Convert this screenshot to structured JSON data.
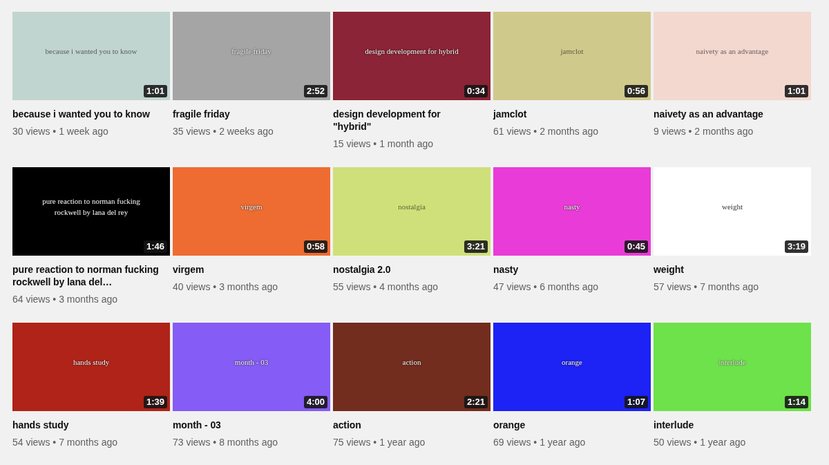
{
  "videos": [
    {
      "title": "because i wanted you to know",
      "meta": "30 views • 1 week ago",
      "duration": "1:01",
      "thumbnail_text": "because i wanted you to know",
      "color": "#c1d5d0",
      "dark_caption": false
    },
    {
      "title": "fragile friday",
      "meta": "35 views • 2 weeks ago",
      "duration": "2:52",
      "thumbnail_text": "fragile friday",
      "color": "#a5a5a5",
      "dark_caption": false
    },
    {
      "title": "design development for \"hybrid\"",
      "meta": "15 views • 1 month ago",
      "duration": "0:34",
      "thumbnail_text": "design development for hybrid",
      "color": "#8b2436",
      "dark_caption": false
    },
    {
      "title": "jamclot",
      "meta": "61 views • 2 months ago",
      "duration": "0:56",
      "thumbnail_text": "jamclot",
      "color": "#d0c98c",
      "dark_caption": false
    },
    {
      "title": "naivety as an advantage",
      "meta": "9 views • 2 months ago",
      "duration": "1:01",
      "thumbnail_text": "naivety as an advantage",
      "color": "#f3d8d0",
      "dark_caption": false
    },
    {
      "title": "pure reaction to norman fucking rockwell by lana del…",
      "meta": "64 views • 3 months ago",
      "duration": "1:46",
      "thumbnail_text": "pure reaction to norman fucking rockwell by lana del rey",
      "color": "#000000",
      "dark_caption": false
    },
    {
      "title": "virgem",
      "meta": "40 views • 3 months ago",
      "duration": "0:58",
      "thumbnail_text": "virgem",
      "color": "#ee6c31",
      "dark_caption": false
    },
    {
      "title": "nostalgia 2.0",
      "meta": "55 views • 4 months ago",
      "duration": "3:21",
      "thumbnail_text": "nostalgia",
      "color": "#cfe07a",
      "dark_caption": false
    },
    {
      "title": "nasty",
      "meta": "47 views • 6 months ago",
      "duration": "0:45",
      "thumbnail_text": "nasty",
      "color": "#e93bd8",
      "dark_caption": false
    },
    {
      "title": "weight",
      "meta": "57 views • 7 months ago",
      "duration": "3:19",
      "thumbnail_text": "weight",
      "color": "#ffffff",
      "dark_caption": true
    },
    {
      "title": "hands study",
      "meta": "54 views • 7 months ago",
      "duration": "1:39",
      "thumbnail_text": "hands study",
      "color": "#b02318",
      "dark_caption": false
    },
    {
      "title": "month - 03",
      "meta": "73 views • 8 months ago",
      "duration": "4:00",
      "thumbnail_text": "month - 03",
      "color": "#855cf5",
      "dark_caption": false
    },
    {
      "title": "action",
      "meta": "75 views • 1 year ago",
      "duration": "2:21",
      "thumbnail_text": "action",
      "color": "#722d1f",
      "dark_caption": false
    },
    {
      "title": "orange",
      "meta": "69 views • 1 year ago",
      "duration": "1:07",
      "thumbnail_text": "orange",
      "color": "#1d22f5",
      "dark_caption": false
    },
    {
      "title": "interlude",
      "meta": "50 views • 1 year ago",
      "duration": "1:14",
      "thumbnail_text": "interlude",
      "color": "#6de24a",
      "dark_caption": false
    }
  ]
}
